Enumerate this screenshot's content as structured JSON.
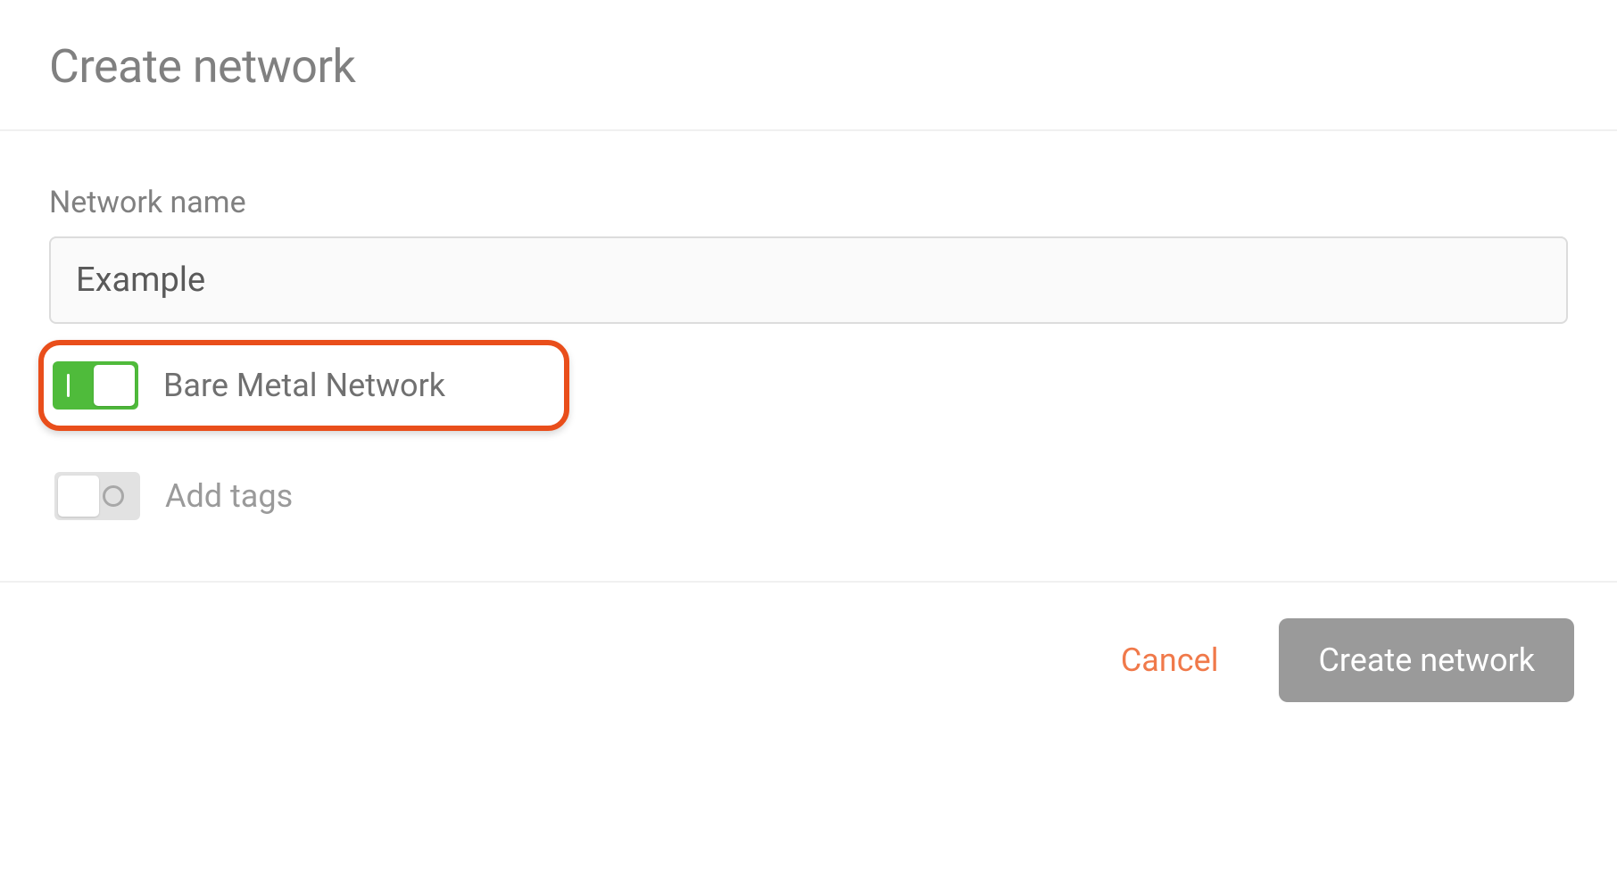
{
  "header": {
    "title": "Create network"
  },
  "form": {
    "name_label": "Network name",
    "name_value": "Example",
    "bare_metal": {
      "label": "Bare Metal Network",
      "enabled": true
    },
    "add_tags": {
      "label": "Add tags",
      "enabled": false
    }
  },
  "footer": {
    "cancel": "Cancel",
    "submit": "Create network"
  }
}
